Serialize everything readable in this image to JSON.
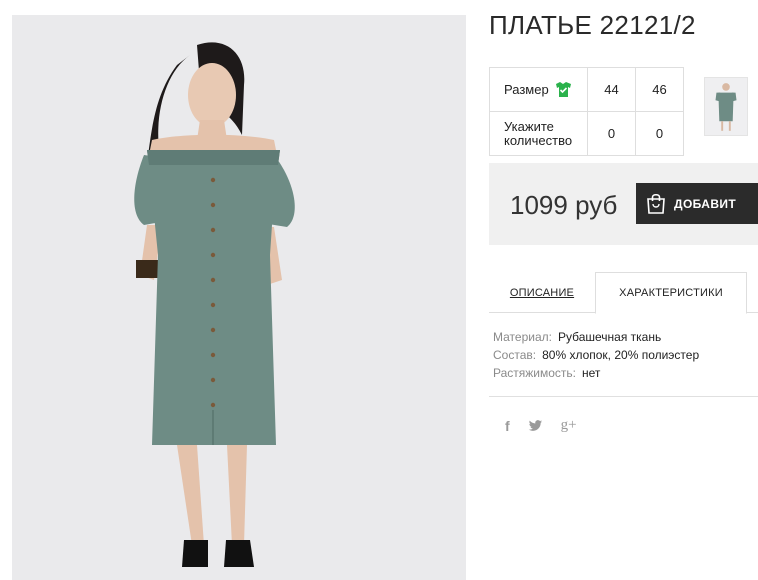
{
  "product": {
    "title": "ПЛАТЬЕ 22121/2",
    "price": "1099 руб",
    "buy_label": "ДОБАВИТ"
  },
  "size_table": {
    "size_label": "Размер",
    "qty_label": "Укажите количество",
    "sizes": [
      "44",
      "46"
    ],
    "quantities": [
      "0",
      "0"
    ]
  },
  "tabs": {
    "description": "ОПИСАНИЕ",
    "characteristics": "ХАРАКТЕРИСТИКИ"
  },
  "characteristics": [
    {
      "key": "Материал:",
      "value": "Рубашечная ткань"
    },
    {
      "key": "Состав:",
      "value": "80% хлопок, 20% полиэстер"
    },
    {
      "key": "Растяжимость:",
      "value": "нет"
    }
  ],
  "social": {
    "facebook": "f",
    "twitter": "🐦",
    "google_plus": "g+"
  },
  "colors": {
    "dress": "#6e8c85",
    "button_bg": "#2b2b2b",
    "size_icon": "#2bb24c",
    "price_box_bg": "#f0f0f0"
  }
}
